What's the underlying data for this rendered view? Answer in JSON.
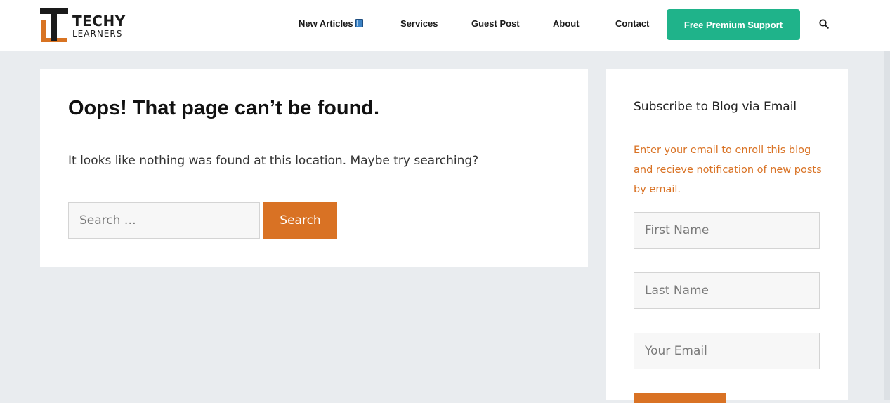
{
  "header": {
    "logo": {
      "line1": "TECHY",
      "line2": "LEARNERS"
    },
    "nav": [
      {
        "label": "New Articles"
      },
      {
        "label": "Services"
      },
      {
        "label": "Guest Post"
      },
      {
        "label": "About"
      },
      {
        "label": "Contact"
      }
    ],
    "cta_label": "Free Premium Support",
    "search_icon": "search-icon",
    "colors": {
      "cta": "#1fb38a"
    }
  },
  "main": {
    "title": "Oops! That page can’t be found.",
    "message": "It looks like nothing was found at this location. Maybe try searching?",
    "search": {
      "placeholder": "Search …",
      "value": "",
      "button_label": "Search"
    },
    "colors": {
      "accent": "#d97224"
    }
  },
  "sidebar": {
    "title": "Subscribe to Blog via Email",
    "description": "Enter your email to enroll this blog and recieve notification of new posts by email.",
    "fields": [
      {
        "placeholder": "First Name"
      },
      {
        "placeholder": "Last Name"
      },
      {
        "placeholder": "Your Email"
      }
    ]
  }
}
